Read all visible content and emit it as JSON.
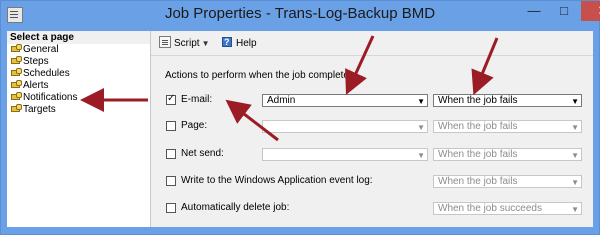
{
  "window": {
    "title": "Job Properties - Trans-Log-Backup BMD",
    "min_glyph": "—",
    "max_glyph": "□",
    "close_glyph": "✕"
  },
  "sidebar": {
    "header": "Select a page",
    "items": [
      {
        "label": "General"
      },
      {
        "label": "Steps"
      },
      {
        "label": "Schedules"
      },
      {
        "label": "Alerts"
      },
      {
        "label": "Notifications"
      },
      {
        "label": "Targets"
      }
    ]
  },
  "toolbar": {
    "script_label": "Script",
    "help_label": "Help"
  },
  "form": {
    "section_label": "Actions to perform when the job completes:",
    "rows": [
      {
        "label": "E-mail:",
        "checked": true,
        "operator": "Admin",
        "condition": "When the job fails"
      },
      {
        "label": "Page:",
        "checked": false,
        "operator": "",
        "condition": "When the job fails"
      },
      {
        "label": "Net send:",
        "checked": false,
        "operator": "",
        "condition": "When the job fails"
      },
      {
        "label": "Write to the Windows Application event log:",
        "checked": false,
        "condition": "When the job fails"
      },
      {
        "label": "Automatically delete job:",
        "checked": false,
        "condition": "When the job succeeds"
      }
    ]
  },
  "colors": {
    "annotation_arrow": "#9b1c24",
    "title_bar": "#6aa0e6",
    "close_button": "#c7504c"
  }
}
